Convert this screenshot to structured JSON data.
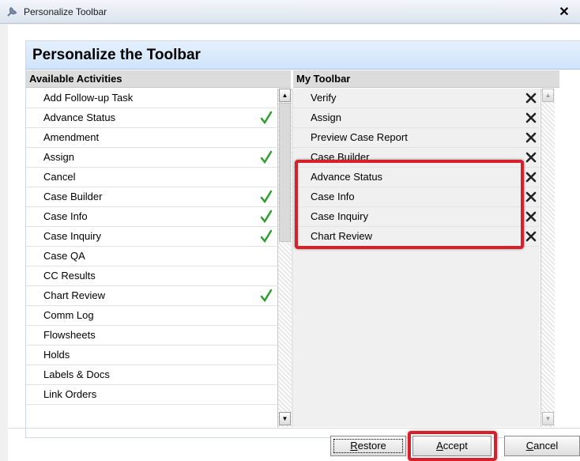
{
  "window": {
    "title": "Personalize Toolbar"
  },
  "panel": {
    "title": "Personalize the Toolbar"
  },
  "available": {
    "header": "Available Activities",
    "items": [
      {
        "label": "Add Follow-up Task",
        "checked": false
      },
      {
        "label": "Advance Status",
        "checked": true
      },
      {
        "label": "Amendment",
        "checked": false
      },
      {
        "label": "Assign",
        "checked": true
      },
      {
        "label": "Cancel",
        "checked": false
      },
      {
        "label": "Case Builder",
        "checked": true
      },
      {
        "label": "Case Info",
        "checked": true
      },
      {
        "label": "Case Inquiry",
        "checked": true
      },
      {
        "label": "Case QA",
        "checked": false
      },
      {
        "label": "CC Results",
        "checked": false
      },
      {
        "label": "Chart Review",
        "checked": true
      },
      {
        "label": "Comm Log",
        "checked": false
      },
      {
        "label": "Flowsheets",
        "checked": false
      },
      {
        "label": "Holds",
        "checked": false
      },
      {
        "label": "Labels & Docs",
        "checked": false
      },
      {
        "label": "Link Orders",
        "checked": false
      }
    ]
  },
  "toolbar": {
    "header": "My Toolbar",
    "items": [
      "Verify",
      "Assign",
      "Preview Case Report",
      "Case Builder",
      "Advance Status",
      "Case Info",
      "Case Inquiry",
      "Chart Review"
    ]
  },
  "buttons": {
    "restore": {
      "first": "R",
      "rest": "estore"
    },
    "accept": {
      "first": "A",
      "rest": "ccept"
    },
    "cancel": {
      "first": "C",
      "rest": "ancel"
    }
  },
  "colors": {
    "highlight": "#d8202a",
    "check": "#2e9e2e",
    "header_bg": "#cfe4fb"
  }
}
